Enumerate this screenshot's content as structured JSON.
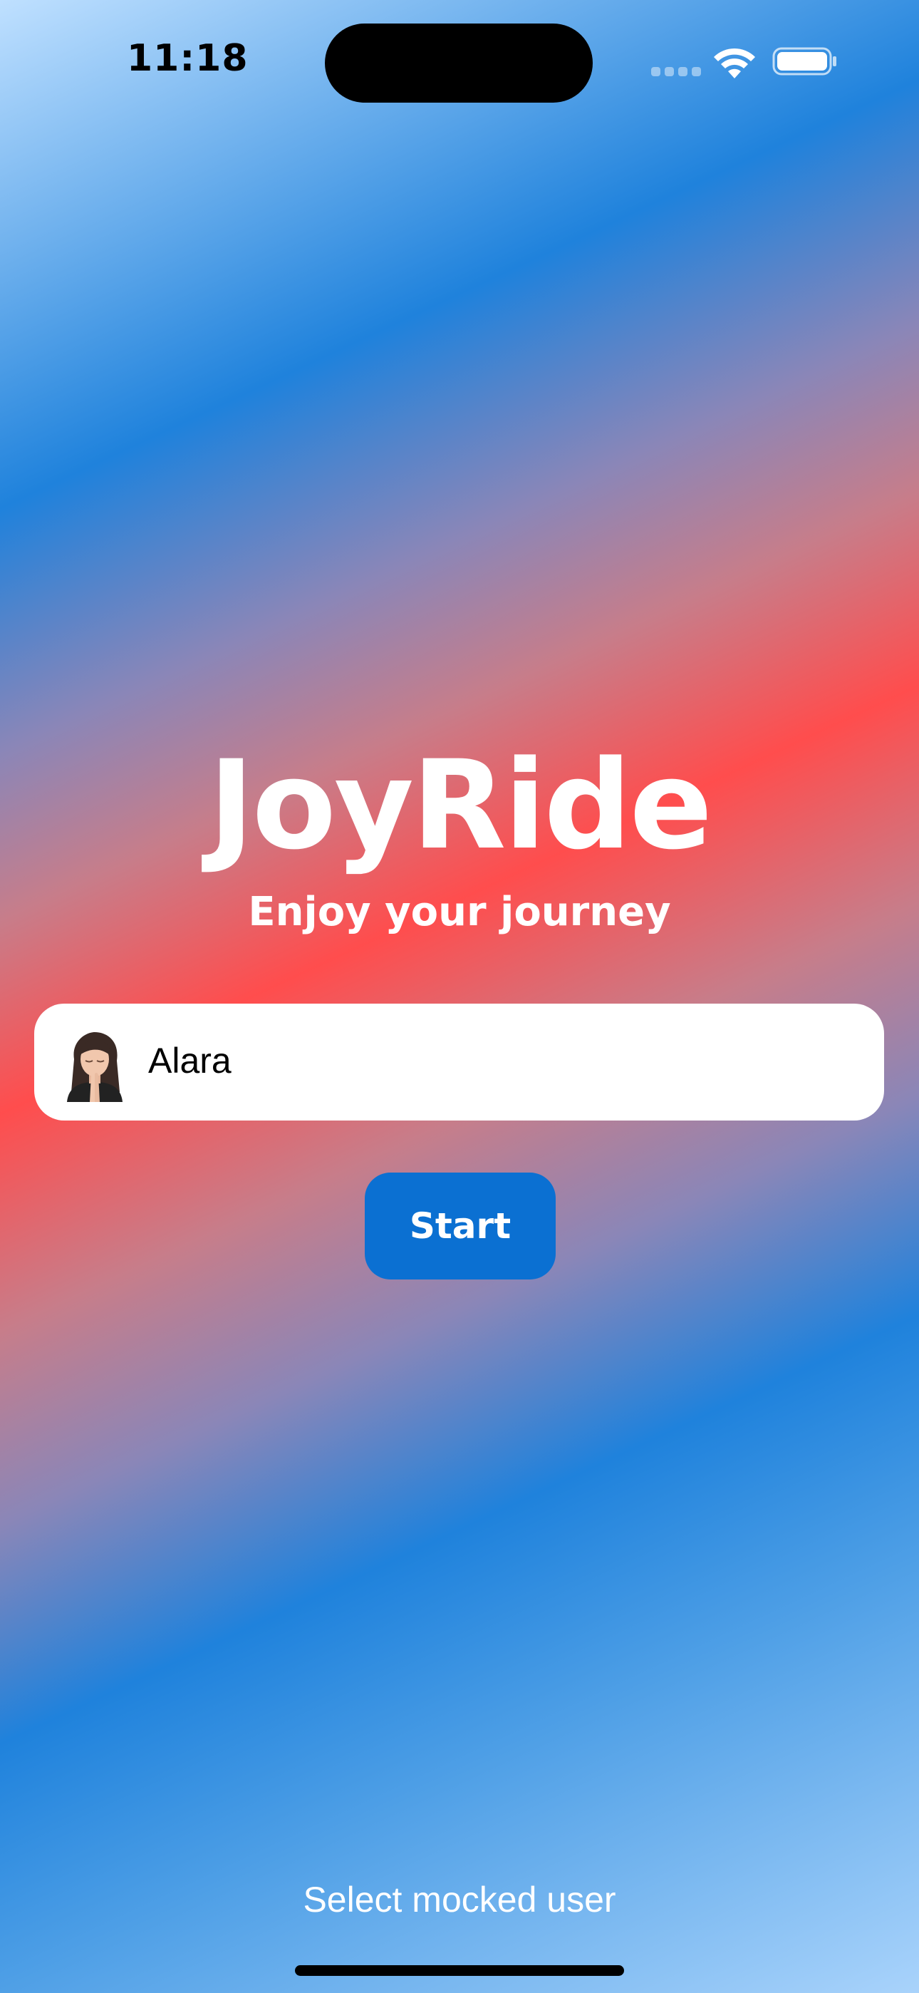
{
  "status_bar": {
    "time": "11:18",
    "icons": [
      "cellular-signal-icon",
      "wifi-icon",
      "battery-icon"
    ]
  },
  "brand": {
    "title": "JoyRide",
    "subtitle": "Enjoy your journey"
  },
  "user_field": {
    "avatar_icon": "memoji-avatar-icon",
    "name": "Alara"
  },
  "start_button": {
    "label": "Start",
    "color": "#0B70D2"
  },
  "footer": {
    "link_text": "Select mocked user"
  },
  "colors": {
    "gradient_blue": "#1F82DC",
    "gradient_red": "#FF4D4D",
    "text_primary": "#FFFFFF"
  }
}
